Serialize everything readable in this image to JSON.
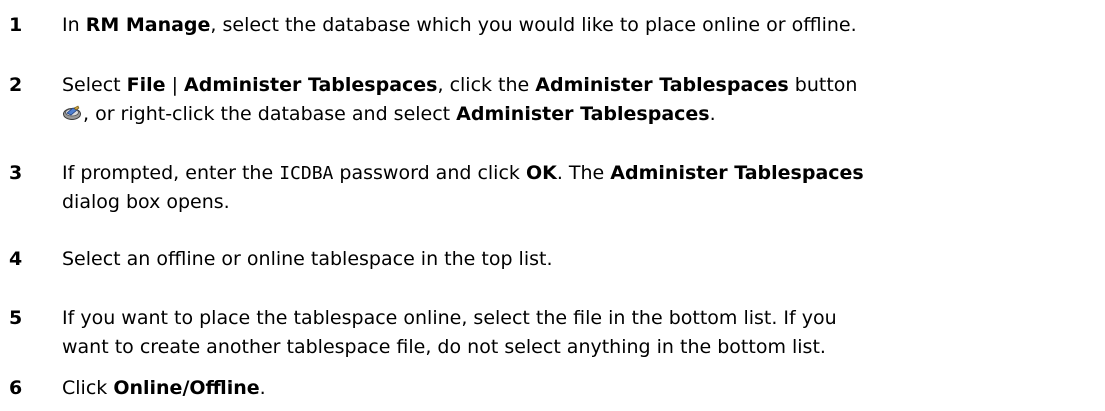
{
  "steps": [
    {
      "number": "1",
      "t1": "In ",
      "b1": "RM Manage",
      "t2": ", select the database which you would like to place online or offline."
    },
    {
      "number": "2",
      "t1": "Select ",
      "b1": "File",
      "t2": " | ",
      "b2": "Administer Tablespaces",
      "t3": ", click the ",
      "b3": "Administer Tablespaces",
      "t4": " button",
      "icon": "administer-tablespaces-icon",
      "t5": ", or right-click the database and select ",
      "b4": "Administer Tablespaces",
      "t6": "."
    },
    {
      "number": "3",
      "t1": "If prompted, enter the ",
      "code1": "ICDBA",
      "t2": " password and click ",
      "b1": "OK",
      "t3": ". The ",
      "b2": "Administer Tablespaces",
      "t4": "dialog box opens."
    },
    {
      "number": "4",
      "t1": "Select an offline or online tablespace in the top list."
    },
    {
      "number": "5",
      "t1": "If you want to place the tablespace online, select the file in the bottom list. If you",
      "t2": "want to create another tablespace file, do not select anything in the bottom list."
    },
    {
      "number": "6",
      "t1": "Click ",
      "b1": "Online/Offline",
      "t2": "."
    }
  ]
}
